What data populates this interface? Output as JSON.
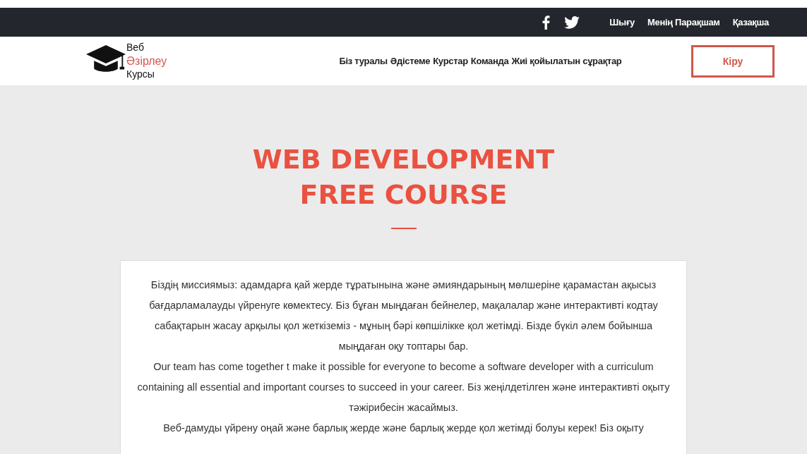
{
  "top_bar": {
    "links": [
      "Шығу",
      "Менің Парақшам",
      "Қазақша"
    ]
  },
  "logo": {
    "lines": [
      "Веб",
      "Әзірлеу",
      "Курсы"
    ]
  },
  "nav": {
    "items": [
      "Біз туралы",
      "Әдістеме",
      "Курстар",
      "Команда",
      "Жиі қойылатын сұрақтар"
    ]
  },
  "login_button": "Кіру",
  "hero": {
    "title_lines": [
      "WEB DEVELOPMENT",
      "FREE COURSE"
    ]
  },
  "content": {
    "paragraphs": [
      "Біздің миссиямыз: адамдарға қай жерде тұратынына және әмияндарының мөлшеріне қарамастан ақысыз бағдарламалауды үйренуге көмектесу. Біз бұған мыңдаған бейнелер, мақалалар және интерактивті кодтау сабақтарын жасау арқылы қол жеткіземіз - мұның бәрі көпшілікке қол жетімді. Бізде бүкіл әлем бойынша мыңдаған оқу топтары бар.",
      "Our team has come together t make it possible for everyone to become a software developer with a curriculum containing all essential and important courses to succeed in your career. Біз жеңілдетілген және интерактивті оқыту тәжірибесін жасаймыз.",
      "Веб-дамуды үйрену оңай және барлық жерде және барлық жерде қол жетімді болуы керек! Біз оқыту"
    ]
  }
}
